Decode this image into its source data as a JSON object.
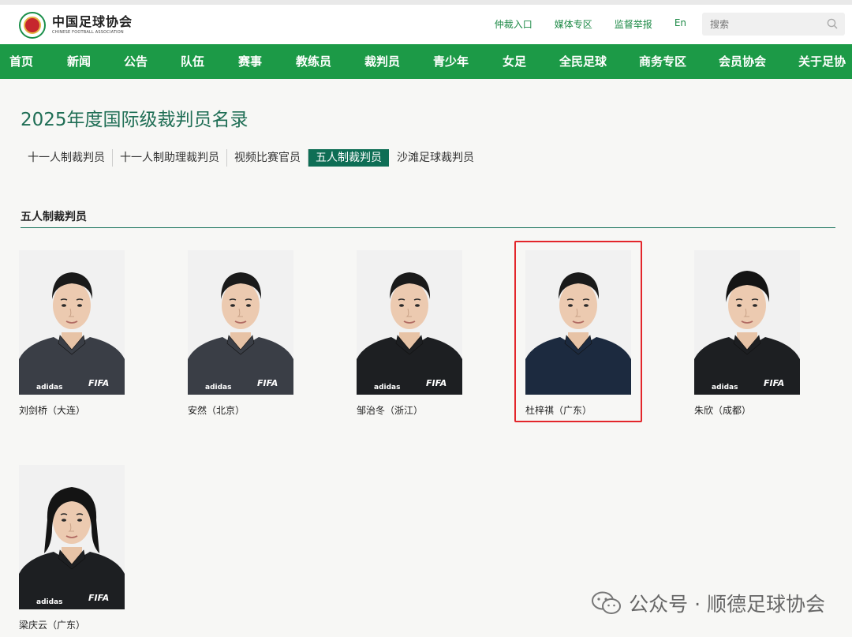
{
  "brand": {
    "cn": "中国足球协会",
    "en": "CHINESE FOOTBALL ASSOCIATION"
  },
  "toplinks": [
    "仲裁入口",
    "媒体专区",
    "监督举报",
    "En"
  ],
  "search": {
    "placeholder": "搜索"
  },
  "nav": [
    "首页",
    "新闻",
    "公告",
    "队伍",
    "赛事",
    "教练员",
    "裁判员",
    "青少年",
    "女足",
    "全民足球",
    "商务专区",
    "会员协会",
    "关于足协"
  ],
  "page": {
    "title": "2025年度国际级裁判员名录"
  },
  "subtabs": [
    {
      "label": "十一人制裁判员",
      "active": false
    },
    {
      "label": "十一人制助理裁判员",
      "active": false
    },
    {
      "label": "视频比赛官员",
      "active": false
    },
    {
      "label": "五人制裁判员",
      "active": true
    },
    {
      "label": "沙滩足球裁判员",
      "active": false
    }
  ],
  "section": {
    "title": "五人制裁判员"
  },
  "referees": [
    {
      "caption": "刘剑桥（大连）",
      "jersey": "grey",
      "highlighted": false
    },
    {
      "caption": "安然（北京）",
      "jersey": "grey",
      "highlighted": false
    },
    {
      "caption": "邹治冬（浙江）",
      "jersey": "black",
      "highlighted": false
    },
    {
      "caption": "杜梓祺（广东）",
      "jersey": "navy",
      "highlighted": true
    },
    {
      "caption": "朱欣（成都）",
      "jersey": "black",
      "highlighted": false
    },
    {
      "caption": "梁庆云（广东）",
      "jersey": "black",
      "highlighted": false
    }
  ],
  "photo_marks": {
    "sponsor": "adidas",
    "fifa": "FIFA"
  },
  "colors": {
    "primary_green": "#1c9a47",
    "dark_green": "#0e6e55",
    "highlight_red": "#e3262b"
  },
  "watermark": {
    "text": "公众号 · 顺德足球协会"
  }
}
